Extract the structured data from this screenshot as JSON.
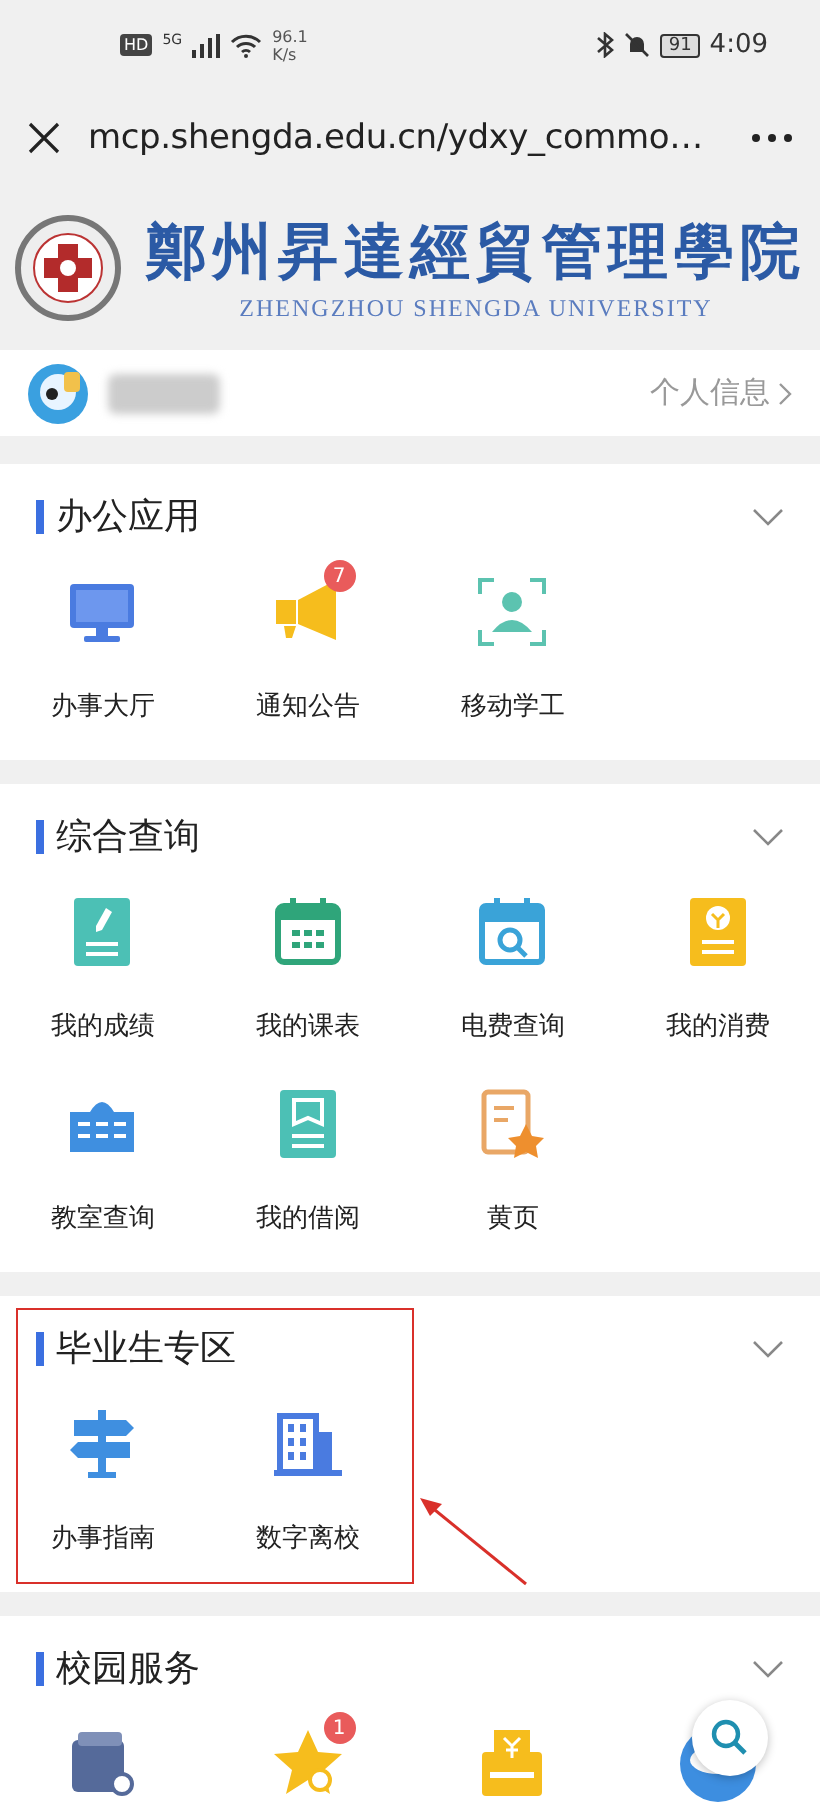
{
  "status_bar": {
    "network": "HD",
    "signal": "5G",
    "speed": "96.1",
    "speed_unit": "K/s",
    "battery": "91",
    "time": "4:09"
  },
  "browser": {
    "url": "mcp.shengda.edu.cn/ydxy_commo…"
  },
  "banner": {
    "name": "鄭州昇達經貿管理學院",
    "name_en": "ZHENGZHOU SHENGDA UNIVERSITY"
  },
  "user": {
    "link": "个人信息"
  },
  "sections": [
    {
      "title": "办公应用",
      "expanded": true,
      "items": [
        {
          "label": "办事大厅",
          "kind": "monitor"
        },
        {
          "label": "通知公告",
          "kind": "megaphone",
          "badge": "7"
        },
        {
          "label": "移动学工",
          "kind": "scan"
        }
      ]
    },
    {
      "title": "综合查询",
      "expanded": true,
      "items": [
        {
          "label": "我的成绩",
          "kind": "grade"
        },
        {
          "label": "我的课表",
          "kind": "calendar"
        },
        {
          "label": "电费查询",
          "kind": "lookup"
        },
        {
          "label": "我的消费",
          "kind": "coin"
        },
        {
          "label": "教室查询",
          "kind": "building"
        },
        {
          "label": "我的借阅",
          "kind": "book"
        },
        {
          "label": "黄页",
          "kind": "favorite"
        }
      ]
    },
    {
      "title": "毕业生专区",
      "expanded": true,
      "highlighted": true,
      "items": [
        {
          "label": "办事指南",
          "kind": "signpost"
        },
        {
          "label": "数字离校",
          "kind": "office"
        }
      ]
    },
    {
      "title": "校园服务",
      "expanded": true,
      "items": [
        {
          "kind": "wallet"
        },
        {
          "kind": "star",
          "badge": "1"
        },
        {
          "kind": "receipt"
        },
        {
          "kind": "mascot"
        }
      ]
    }
  ]
}
